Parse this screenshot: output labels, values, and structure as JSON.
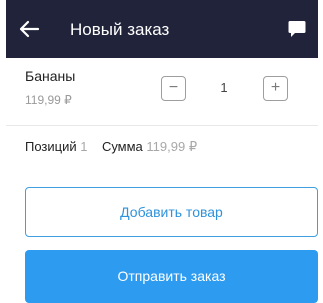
{
  "header": {
    "title": "Новый заказ",
    "back_icon": "arrow-left-icon",
    "chat_icon": "chat-bubble-icon",
    "background": "#21233a"
  },
  "item": {
    "name": "Бананы",
    "price": "119,99 ₽",
    "quantity": "1",
    "minus_label": "−",
    "plus_label": "+"
  },
  "summary": {
    "positions_label": "Позиций",
    "positions_value": "1",
    "sum_label": "Сумма",
    "sum_value": "119,99 ₽"
  },
  "actions": {
    "add_label": "Добавить товар",
    "send_label": "Отправить заказ",
    "accent": "#2d9bf0"
  }
}
